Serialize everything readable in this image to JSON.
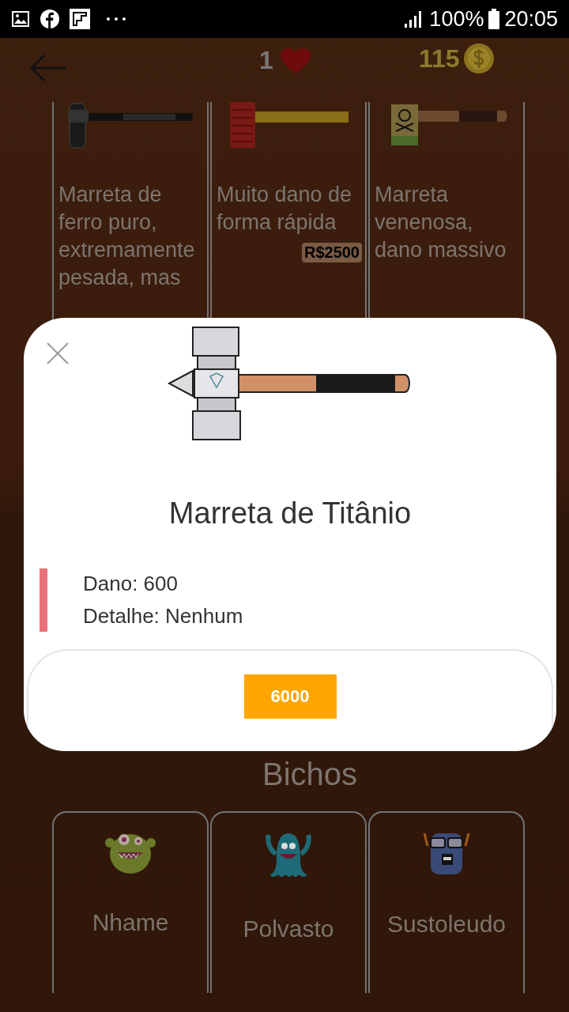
{
  "status_bar": {
    "battery": "100%",
    "time": "20:05"
  },
  "header": {
    "lives": "1",
    "coins": "115"
  },
  "hammers": [
    {
      "description": "Marreta de ferro puro, extremamente pesada, mas"
    },
    {
      "description": "Muito dano de forma rápida",
      "price": "R$2500"
    },
    {
      "description": "Marreta venenosa, dano massivo"
    }
  ],
  "dialog": {
    "title": "Marreta de Titânio",
    "stats": [
      "Dano: 600",
      "Detalhe: Nenhum"
    ],
    "buy_button": "6000"
  },
  "section_title": "Bichos",
  "monsters": [
    {
      "name": "Nhame"
    },
    {
      "name": "Polvasto"
    },
    {
      "name": "Sustoleudo"
    }
  ]
}
